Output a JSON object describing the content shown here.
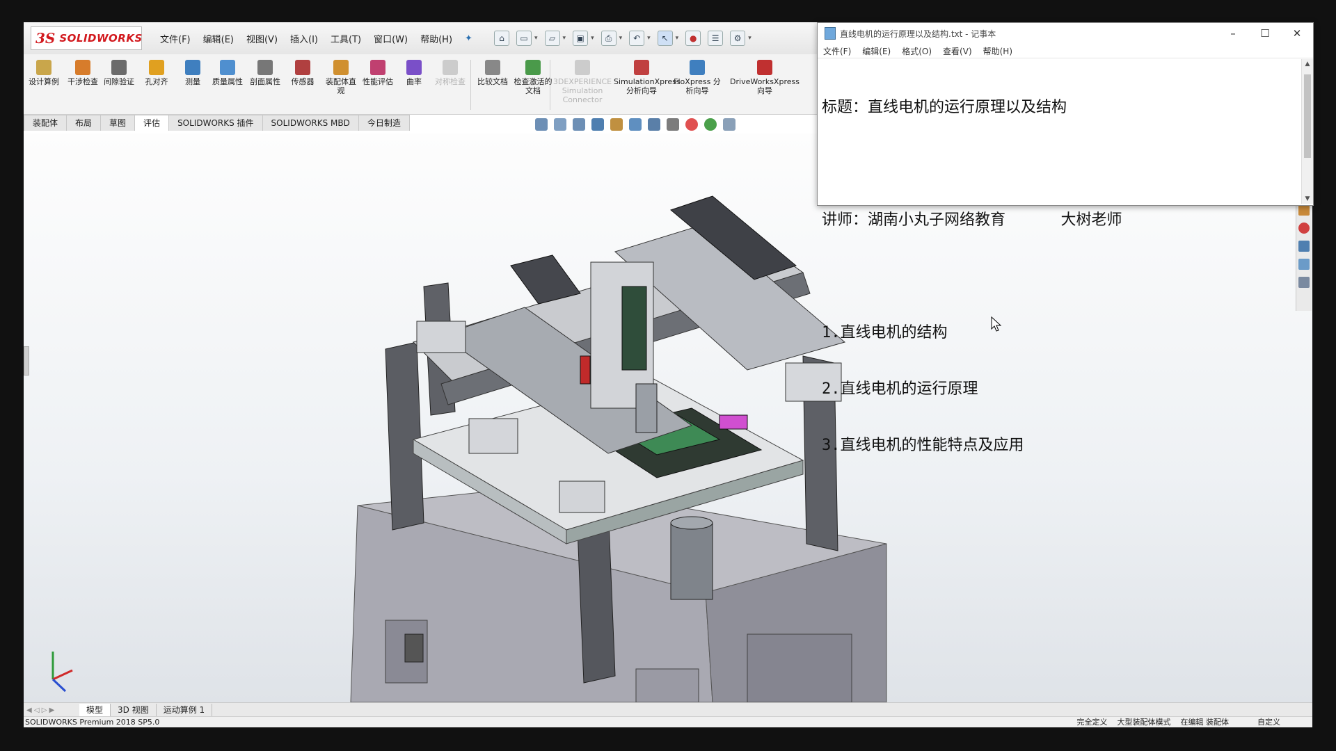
{
  "solidworks": {
    "logo_mark": "3S",
    "logo_text": "SOLIDWORKS",
    "menus": [
      "文件(F)",
      "编辑(E)",
      "视图(V)",
      "插入(I)",
      "工具(T)",
      "窗口(W)",
      "帮助(H)"
    ],
    "command_buttons": [
      {
        "label": "设计算例",
        "icon": "design-study-icon",
        "color": "#c9a64b"
      },
      {
        "label": "干涉检查",
        "icon": "interference-icon",
        "color": "#d77c2b"
      },
      {
        "label": "间隙验证",
        "icon": "clearance-icon",
        "color": "#6b6b6b"
      },
      {
        "label": "孔对齐",
        "icon": "hole-align-icon",
        "color": "#e0a020"
      },
      {
        "label": "测量",
        "icon": "measure-icon",
        "color": "#3f7fbf"
      },
      {
        "label": "质量属性",
        "icon": "mass-icon",
        "color": "#4f8fcf"
      },
      {
        "label": "剖面属性",
        "icon": "section-icon",
        "color": "#777777"
      },
      {
        "label": "传感器",
        "icon": "sensor-icon",
        "color": "#b04040"
      },
      {
        "label": "装配体直观",
        "icon": "assembly-visual-icon",
        "color": "#d09030"
      },
      {
        "label": "性能评估",
        "icon": "performance-icon",
        "color": "#c04070"
      },
      {
        "label": "曲率",
        "icon": "curvature-icon",
        "color": "#7a4fc8"
      },
      {
        "label": "对称检查",
        "icon": "symmetry-icon",
        "color": "#cccccc",
        "disabled": true
      },
      {
        "label": "比较文档",
        "icon": "compare-icon",
        "color": "#888888"
      },
      {
        "label": "检查激活的文档",
        "icon": "check-doc-icon",
        "color": "#4a9a4a"
      },
      {
        "label": "3DEXPERIENCE Simulation Connector",
        "icon": "3dx-icon",
        "color": "#cccccc",
        "disabled": true
      },
      {
        "label": "SimulationXpress 分析向导",
        "icon": "simxpress-icon",
        "color": "#c04040"
      },
      {
        "label": "FloXpress 分析向导",
        "icon": "floxpress-icon",
        "color": "#3f7fbf"
      },
      {
        "label": "DriveWorksXpress 向导",
        "icon": "driveworks-icon",
        "color": "#c03030"
      }
    ],
    "tabs": [
      "装配体",
      "布局",
      "草图",
      "评估",
      "SOLIDWORKS 插件",
      "SOLIDWORKS MBD",
      "今日制造"
    ],
    "active_tab": "评估",
    "bottom_tabs": [
      "模型",
      "3D 视图",
      "运动算例 1"
    ],
    "status": {
      "product": "SOLIDWORKS Premium 2018 SP5.0",
      "items": [
        "完全定义",
        "大型装配体模式",
        "在编辑 装配体"
      ],
      "custom": "自定义"
    }
  },
  "notepad": {
    "title": "直线电机的运行原理以及结构.txt - 记事本",
    "menus": [
      "文件(F)",
      "编辑(E)",
      "格式(O)",
      "查看(V)",
      "帮助(H)"
    ],
    "lines": [
      "标题：直线电机的运行原理以及结构",
      "",
      "讲师：湖南小丸子网络教育      大树老师",
      "",
      "1.直线电机的结构",
      "2.直线电机的运行原理",
      "3.直线电机的性能特点及应用"
    ]
  }
}
